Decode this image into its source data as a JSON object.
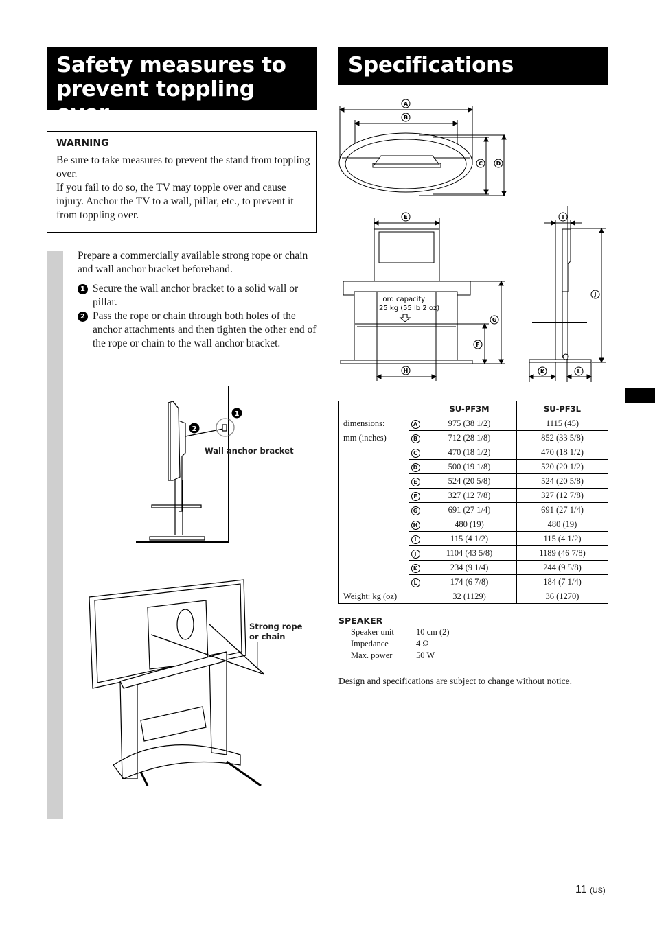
{
  "left_column": {
    "title": "Safety measures to prevent toppling over",
    "warning": {
      "heading": "WARNING",
      "line1": "Be sure to take measures to prevent the stand from toppling over.",
      "line2": "If you fail to do so, the TV may topple over and cause injury. Anchor the TV to a wall, pillar, etc., to prevent it from toppling over."
    },
    "intro": "Prepare a commercially available strong rope or chain and wall anchor bracket beforehand.",
    "steps": [
      {
        "num": "1",
        "text": "Secure the wall anchor bracket to a solid wall or pillar."
      },
      {
        "num": "2",
        "text": "Pass the rope or chain through both holes of the anchor attachments and then tighten the other end of the rope or chain to the wall anchor bracket."
      }
    ],
    "figure1": {
      "callout_1": "1",
      "callout_2": "2",
      "label": "Wall anchor bracket"
    },
    "figure2": {
      "label_line1": "Strong rope",
      "label_line2": "or chain"
    }
  },
  "right_column": {
    "title": "Specifications",
    "diagram_labels": {
      "A": "A",
      "B": "B",
      "C": "C",
      "D": "D",
      "E": "E",
      "F": "F",
      "G": "G",
      "H": "H",
      "I": "I",
      "J": "J",
      "K": "K",
      "L": "L",
      "load_line1": "Lord capacity",
      "load_line2": "25 kg (55 lb 2 oz)"
    },
    "table": {
      "headers": [
        "",
        "SU-PF3M",
        "SU-PF3L"
      ],
      "dim_label_line1": "dimensions:",
      "dim_label_line2": "mm (inches)",
      "rows": [
        {
          "letter": "A",
          "m": "975 (38 1/2)",
          "l": "1115 (45)"
        },
        {
          "letter": "B",
          "m": "712 (28 1/8)",
          "l": "852 (33 5/8)"
        },
        {
          "letter": "C",
          "m": "470 (18 1/2)",
          "l": "470 (18 1/2)"
        },
        {
          "letter": "D",
          "m": "500 (19 1/8)",
          "l": "520 (20 1/2)"
        },
        {
          "letter": "E",
          "m": "524 (20 5/8)",
          "l": "524 (20 5/8)"
        },
        {
          "letter": "F",
          "m": "327 (12 7/8)",
          "l": "327 (12 7/8)"
        },
        {
          "letter": "G",
          "m": "691 (27 1/4)",
          "l": "691 (27 1/4)"
        },
        {
          "letter": "H",
          "m": "480 (19)",
          "l": "480 (19)"
        },
        {
          "letter": "I",
          "m": "115 (4 1/2)",
          "l": "115 (4 1/2)"
        },
        {
          "letter": "J",
          "m": "1104 (43 5/8)",
          "l": "1189 (46 7/8)"
        },
        {
          "letter": "K",
          "m": "234 (9 1/4)",
          "l": "244 (9 5/8)"
        },
        {
          "letter": "L",
          "m": "174 (6 7/8)",
          "l": "184 (7 1/4)"
        }
      ],
      "weight": {
        "label": "Weight: kg (oz)",
        "m": "32 (1129)",
        "l": "36 (1270)"
      }
    },
    "speaker": {
      "heading": "SPEAKER",
      "rows": [
        {
          "key": "Speaker unit",
          "value": "10 cm (2)"
        },
        {
          "key": "Impedance",
          "value": "4 Ω"
        },
        {
          "key": "Max. power",
          "value": "50 W"
        }
      ]
    },
    "notice": "Design and specifications are subject to change without notice."
  },
  "footer": {
    "page_number": "11",
    "region": "(US)"
  }
}
